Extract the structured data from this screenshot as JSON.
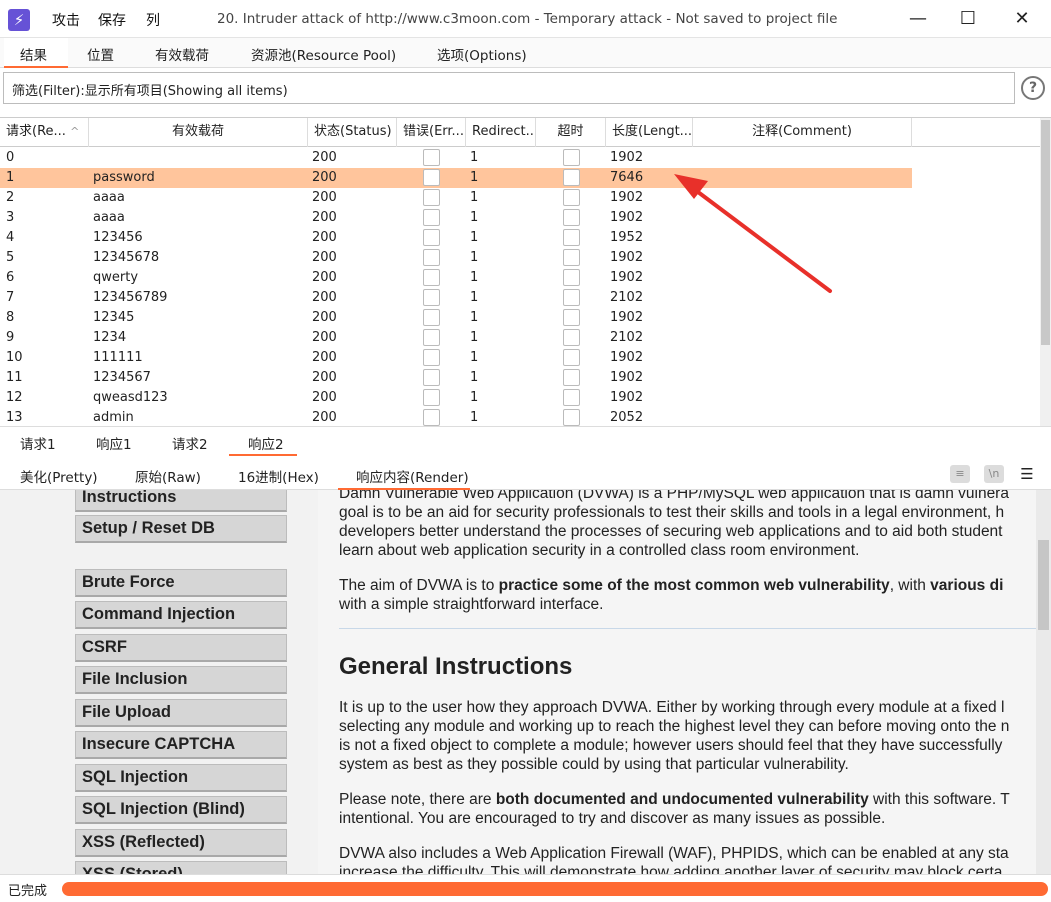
{
  "titlebar": {
    "menus": [
      "攻击",
      "保存",
      "列"
    ],
    "title": "20. Intruder attack of http://www.c3moon.com - Temporary attack - Not saved to project file",
    "minimize": "—",
    "maximize": "☐",
    "close": "✕"
  },
  "main_tabs": [
    "结果",
    "位置",
    "有效载荷",
    "资源池(Resource Pool)",
    "选项(Options)"
  ],
  "filter": {
    "text": "筛选(Filter):显示所有项目(Showing all items)",
    "help": "?"
  },
  "table": {
    "columns": [
      "请求(Re...",
      "有效载荷",
      "状态(Status)",
      "错误(Err...",
      "Redirect...",
      "超时",
      "长度(Lengt...",
      "注释(Comment)"
    ],
    "sort_indicator": "^",
    "rows": [
      {
        "id": "0",
        "payload": "",
        "status": "200",
        "redirect": "1",
        "length": "1902",
        "comment": ""
      },
      {
        "id": "1",
        "payload": "password",
        "status": "200",
        "redirect": "1",
        "length": "7646",
        "comment": "",
        "selected": true
      },
      {
        "id": "2",
        "payload": "aaaa",
        "status": "200",
        "redirect": "1",
        "length": "1902",
        "comment": ""
      },
      {
        "id": "3",
        "payload": "aaaa",
        "status": "200",
        "redirect": "1",
        "length": "1902",
        "comment": ""
      },
      {
        "id": "4",
        "payload": "123456",
        "status": "200",
        "redirect": "1",
        "length": "1952",
        "comment": ""
      },
      {
        "id": "5",
        "payload": "12345678",
        "status": "200",
        "redirect": "1",
        "length": "1902",
        "comment": ""
      },
      {
        "id": "6",
        "payload": "qwerty",
        "status": "200",
        "redirect": "1",
        "length": "1902",
        "comment": ""
      },
      {
        "id": "7",
        "payload": "123456789",
        "status": "200",
        "redirect": "1",
        "length": "2102",
        "comment": ""
      },
      {
        "id": "8",
        "payload": "12345",
        "status": "200",
        "redirect": "1",
        "length": "1902",
        "comment": ""
      },
      {
        "id": "9",
        "payload": "1234",
        "status": "200",
        "redirect": "1",
        "length": "2102",
        "comment": ""
      },
      {
        "id": "10",
        "payload": "111111",
        "status": "200",
        "redirect": "1",
        "length": "1902",
        "comment": ""
      },
      {
        "id": "11",
        "payload": "1234567",
        "status": "200",
        "redirect": "1",
        "length": "1902",
        "comment": ""
      },
      {
        "id": "12",
        "payload": "qweasd123",
        "status": "200",
        "redirect": "1",
        "length": "1902",
        "comment": ""
      },
      {
        "id": "13",
        "payload": "admin",
        "status": "200",
        "redirect": "1",
        "length": "2052",
        "comment": ""
      }
    ]
  },
  "req_tabs": [
    "请求1",
    "响应1",
    "请求2",
    "响应2"
  ],
  "view_tabs": [
    "美化(Pretty)",
    "原始(Raw)",
    "16进制(Hex)",
    "响应内容(Render)"
  ],
  "view_icons": [
    "wrap-icon",
    "newline-icon",
    "menu-icon"
  ],
  "view_icon_glyphs": [
    "≡",
    "\\n",
    "☰"
  ],
  "render": {
    "menu": [
      "Instructions",
      "Setup / Reset DB",
      "Brute Force",
      "Command Injection",
      "CSRF",
      "File Inclusion",
      "File Upload",
      "Insecure CAPTCHA",
      "SQL Injection",
      "SQL Injection (Blind)",
      "XSS (Reflected)",
      "XSS (Stored)"
    ],
    "intro": [
      "Damn Vulnerable Web Application (DVWA) is a PHP/MySQL web application that is damn vulnera",
      "goal is to be an aid for security professionals to test their skills and tools in a legal environment, h",
      "developers better understand the processes of securing web applications and to aid both student",
      "learn about web application security in a controlled class room environment."
    ],
    "aim_1": "The aim of DVWA is to ",
    "aim_2": "practice some of the most common web vulnerability",
    "aim_3": ", with ",
    "aim_4": "various di",
    "aim_5": "with a simple straightforward interface.",
    "heading": "General Instructions",
    "general": [
      "It is up to the user how they approach DVWA. Either by working through every module at a fixed l",
      "selecting any module and working up to reach the highest level they can before moving onto the n",
      "is not a fixed object to complete a module; however users should feel that they have successfully",
      "system as best as they possible could by using that particular vulnerability."
    ],
    "note_1": "Please note, there are ",
    "note_2": "both documented and undocumented vulnerability",
    "note_3": " with this software. T",
    "note_4": "intentional. You are encouraged to try and discover as many issues as possible.",
    "waf": [
      "DVWA also includes a Web Application Firewall (WAF), PHPIDS, which can be enabled at any sta",
      "increase the difficulty. This will demonstrate how adding another layer of security may block certa"
    ]
  },
  "status": {
    "text": "已完成"
  },
  "colors": {
    "accent": "#ff6a33",
    "selected_row": "#ffc59c",
    "arrow": "#e8302a",
    "app_icon": "#6652d6"
  }
}
